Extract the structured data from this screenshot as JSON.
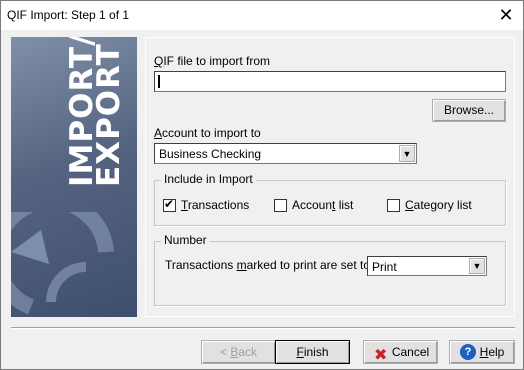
{
  "window": {
    "title": "QIF Import: Step 1 of 1",
    "close_glyph": "✕"
  },
  "sidepanel": {
    "banner_text": "IMPORT/ EXPORT",
    "banner_line1": "IMPORT/",
    "banner_line2": "EXPORT"
  },
  "file": {
    "label_accel": "Q",
    "label_rest": "IF file to import from",
    "value": "",
    "browse_label": "Browse..."
  },
  "account": {
    "label_accel": "A",
    "label_rest": "ccount to import to",
    "selected": "Business Checking"
  },
  "include": {
    "legend": "Include in Import",
    "transactions": {
      "accel": "T",
      "rest": "ransactions",
      "checked": true
    },
    "account_list": {
      "pre": "Accoun",
      "accel": "t",
      "rest": " list",
      "checked": false
    },
    "category_list": {
      "accel": "C",
      "rest": "ategory list",
      "checked": false
    }
  },
  "number": {
    "legend": "Number",
    "label_pre": "Transactions ",
    "label_accel": "m",
    "label_rest": "arked to print are set to",
    "selected": "Print"
  },
  "footer": {
    "back_accel": "B",
    "back_pre": "< ",
    "back_rest": "ack",
    "finish_accel": "F",
    "finish_rest": "inish",
    "cancel_label": "Cancel",
    "help_accel": "H",
    "help_rest": "elp"
  },
  "icons": {
    "close": "close-icon",
    "cancel": "x-icon",
    "help": "help-icon",
    "dropdown": "chevron-down-icon",
    "check": "check-icon"
  },
  "colors": {
    "cancel_red": "#cc1f1f",
    "help_blue": "#1f5fbf",
    "banner_dark": "#3e4e6e",
    "banner_light": "#8090a8"
  }
}
